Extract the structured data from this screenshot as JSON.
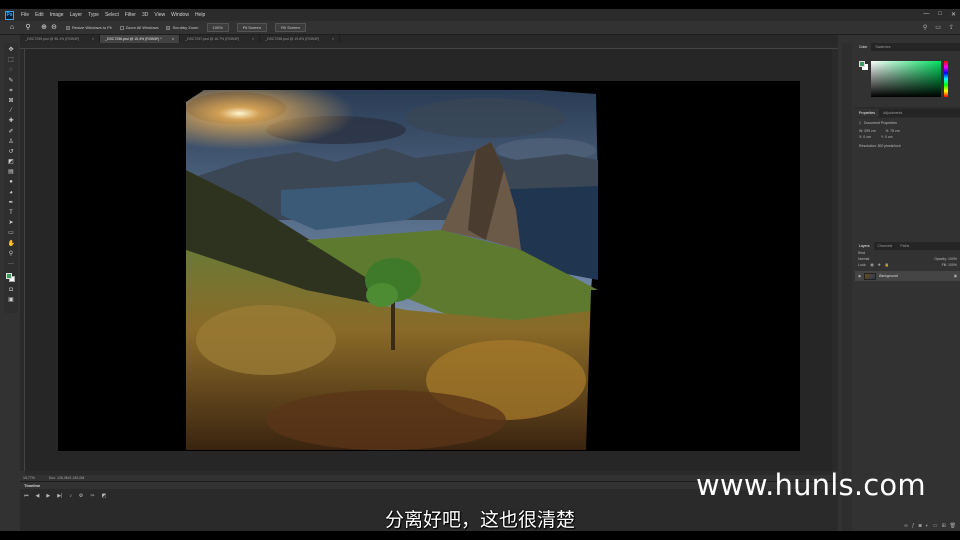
{
  "menu": {
    "logo": "Ps",
    "items": [
      "File",
      "Edit",
      "Image",
      "Layer",
      "Type",
      "Select",
      "Filter",
      "3D",
      "View",
      "Window",
      "Help"
    ],
    "win_min": "—",
    "win_max": "□",
    "win_close": "✕"
  },
  "options": {
    "resize_windows": "Resize Windows to Fit",
    "zoom_all": "Zoom All Windows",
    "scrubby_zoom": "Scrubby Zoom",
    "zoom_100": "100%",
    "fit_screen": "Fit Screen",
    "fill_screen": "Fill Screen"
  },
  "tabs": [
    {
      "label": "_DSC7259.psd @ 96,1% (RGB/8*)",
      "active": false
    },
    {
      "label": "_DSC7256.psd @ 15,4% (RGB/8*) *",
      "active": true
    },
    {
      "label": "_DSC7257.psd @ 16,7% (RGB/8*)",
      "active": false
    },
    {
      "label": "_DSC7258.psd @ 19,6% (RGB/8*)",
      "active": false
    }
  ],
  "status": {
    "zoom": "16,77%",
    "doc": "Doc: 126,3M/1,182,0M"
  },
  "timeline": {
    "title": "Timeline"
  },
  "color_panel": {
    "tabs": [
      "Color",
      "Swatches"
    ],
    "fg_color": "#3d9a62",
    "bg_color": "#ffffff"
  },
  "properties_panel": {
    "tabs": [
      "Properties",
      "Adjustments"
    ],
    "title": "Document Properties",
    "w": "W: 299 cm",
    "h": "H: 75 cm",
    "x": "X: 0 cm",
    "y": "Y: 0 cm",
    "resolution": "Resolution: 300 pixels/inch"
  },
  "layers_panel": {
    "tabs": [
      "Layers",
      "Channels",
      "Paths"
    ],
    "kind": "Kind",
    "blend_mode": "Normal",
    "opacity": "Opacity: 100%",
    "lock": "Lock:",
    "fill": "Fill: 100%",
    "layer_name": "Background"
  },
  "overlay": {
    "watermark": "www.hunls.com",
    "subtitle": "分离好吧，这也很清楚"
  }
}
